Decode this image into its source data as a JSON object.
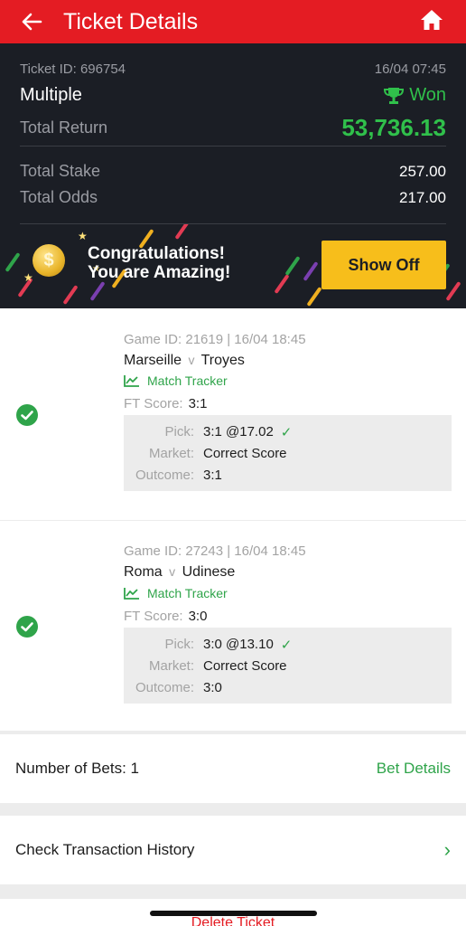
{
  "header": {
    "title": "Ticket Details"
  },
  "ticket": {
    "id_label": "Ticket ID: 696754",
    "datetime": "16/04 07:45",
    "type": "Multiple",
    "status": "Won",
    "total_return_label": "Total Return",
    "total_return": "53,736.13",
    "total_stake_label": "Total Stake",
    "total_stake": "257.00",
    "total_odds_label": "Total Odds",
    "total_odds": "217.00"
  },
  "banner": {
    "line1": "Congratulations!",
    "line2": "You are Amazing!",
    "button": "Show Off",
    "coin_symbol": "$"
  },
  "games": [
    {
      "meta": "Game ID: 21619 | 16/04 18:45",
      "home": "Marseille",
      "vs": "v",
      "away": "Troyes",
      "tracker": "Match Tracker",
      "ft_label": "FT Score:",
      "ft_value": "3:1",
      "pick_label": "Pick:",
      "pick_value": "3:1 @17.02",
      "market_label": "Market:",
      "market_value": "Correct Score",
      "outcome_label": "Outcome:",
      "outcome_value": "3:1"
    },
    {
      "meta": "Game ID: 27243 | 16/04 18:45",
      "home": "Roma",
      "vs": "v",
      "away": "Udinese",
      "tracker": "Match Tracker",
      "ft_label": "FT Score:",
      "ft_value": "3:0",
      "pick_label": "Pick:",
      "pick_value": "3:0 @13.10",
      "market_label": "Market:",
      "market_value": "Correct Score",
      "outcome_label": "Outcome:",
      "outcome_value": "3:0"
    }
  ],
  "bets": {
    "label": "Number of Bets: 1",
    "action": "Bet Details"
  },
  "history": {
    "label": "Check Transaction History"
  },
  "delete": {
    "label": "Delete Ticket"
  },
  "colors": {
    "brand_red": "#e41c23",
    "won_green": "#30c04b",
    "accent_yellow": "#f7be1b"
  }
}
